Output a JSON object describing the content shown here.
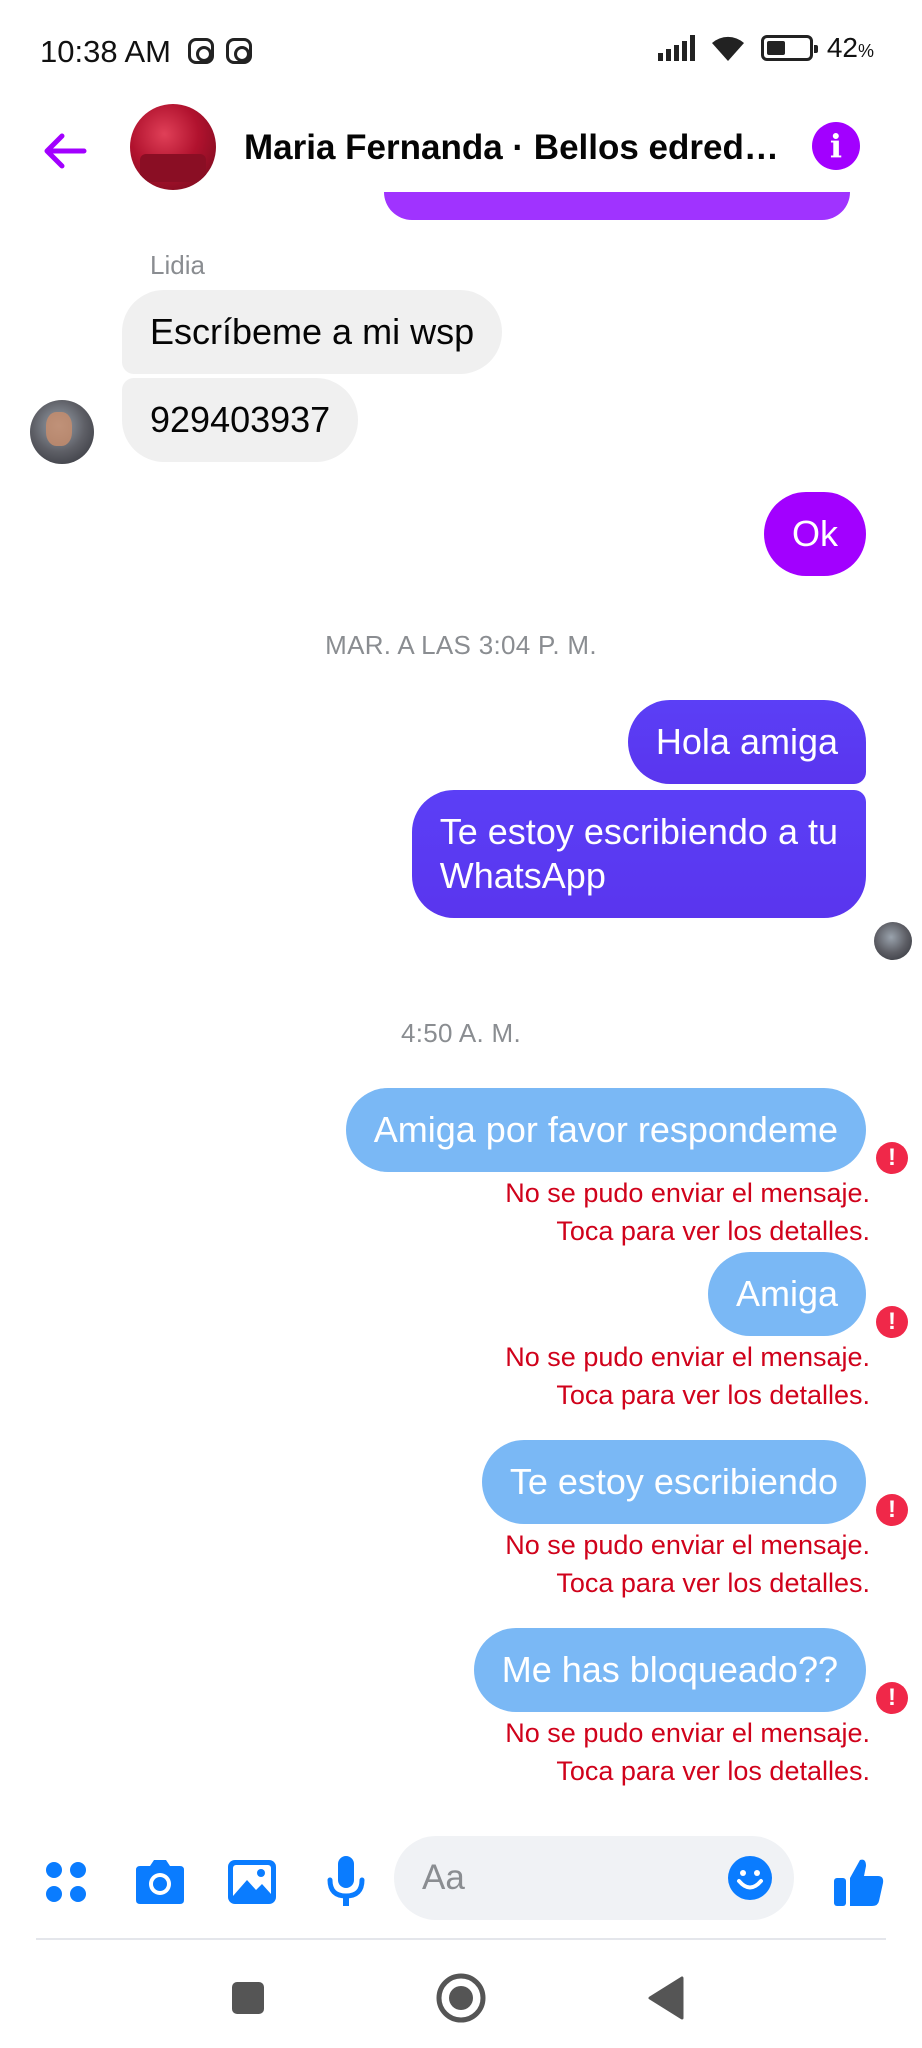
{
  "status_bar": {
    "time": "10:38 AM",
    "battery": "42",
    "battery_unit": "%",
    "icons": [
      "instagram-icon",
      "instagram-icon",
      "signal-icon",
      "wifi-icon",
      "battery-icon"
    ]
  },
  "header": {
    "title": "Maria Fernanda · Bellos edredones",
    "back_icon": "back-arrow-icon",
    "info_icon": "info-icon",
    "info_symbol": "i"
  },
  "messages": {
    "sender_name": "Lidia",
    "incoming": [
      "Escríbeme a mi wsp",
      "929403937"
    ],
    "ok": "Ok",
    "timestamp_1": "MAR. A LAS 3:04 P. M.",
    "sent_1": "Hola amiga",
    "sent_2_line1": "Te estoy escribiendo a tu",
    "sent_2_line2": "WhatsApp",
    "timestamp_2": "4:50 A. M.",
    "failed": [
      "Amiga por favor respondeme",
      "Amiga",
      "Te estoy escribiendo",
      "Me has bloqueado??"
    ],
    "error_line1": "No se pudo enviar el mensaje.",
    "error_line2": "Toca para ver los detalles.",
    "error_symbol": "!"
  },
  "composer": {
    "placeholder": "Aa",
    "icons": [
      "apps-icon",
      "camera-icon",
      "gallery-icon",
      "microphone-icon",
      "emoji-icon",
      "thumbs-up-icon"
    ]
  },
  "colors": {
    "accent_purple": "#a200ff",
    "sent_indigo": "#5b3ff6",
    "failed_blue": "#7ab8f5",
    "error_red": "#d0021b",
    "composer_blue": "#0a7cff"
  }
}
